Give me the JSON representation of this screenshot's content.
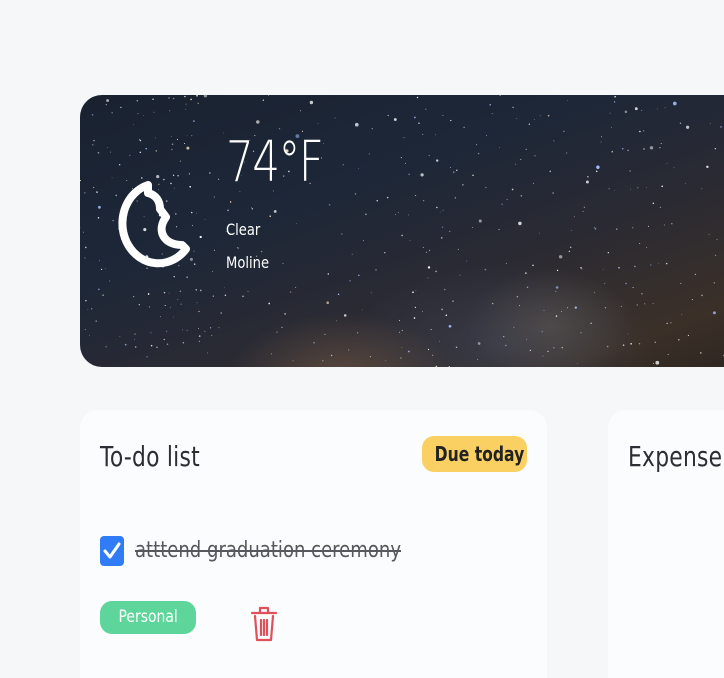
{
  "weather": {
    "temperature": "74°F",
    "condition": "Clear",
    "location": "Moline",
    "icon": "moon-icon"
  },
  "todo": {
    "title": "To-do list",
    "due_badge": "Due today",
    "items": [
      {
        "text": "atttend graduation ceremony",
        "completed": true,
        "tag": "Personal"
      }
    ]
  },
  "expense": {
    "title": "Expense"
  },
  "colors": {
    "due_badge": "#fbd063",
    "checkbox": "#2f7cf6",
    "tag_personal": "#5ed69b",
    "trash": "#e0505a"
  }
}
